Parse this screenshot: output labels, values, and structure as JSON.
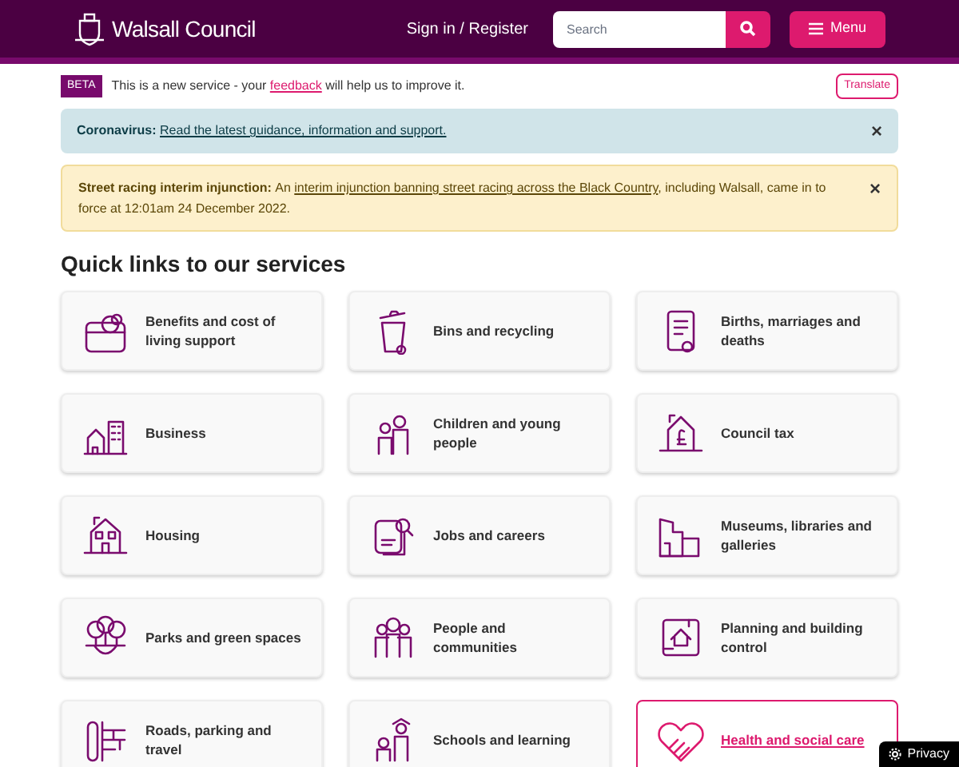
{
  "header": {
    "logo_text": "Walsall Council",
    "sign_in": "Sign in / Register",
    "search": {
      "placeholder": "Search"
    },
    "menu_button": "Menu"
  },
  "beta_banner": {
    "badge": "BETA",
    "text_before": "This is a new service - your ",
    "link": "feedback",
    "text_after": " will help us to improve it.",
    "translate_button": "Translate"
  },
  "alerts": [
    {
      "kind": "info",
      "lead": "Coronavirus:",
      "parts": [
        {
          "text": "Read the latest guidance, information and support.",
          "link": true
        }
      ],
      "close": "×"
    },
    {
      "kind": "warning",
      "lead": "Street racing interim injunction:",
      "parts": [
        {
          "text": "An ",
          "link": false
        },
        {
          "text": "interim injunction banning street racing across the Black Country",
          "link": true
        },
        {
          "text": ", including Walsall, came in to force at 12:01am 24 December 2022.",
          "link": false
        }
      ],
      "close": "×"
    }
  ],
  "quick_links": {
    "heading": "Quick links to our services",
    "items": [
      {
        "label": "Benefits and cost of living support",
        "highlighted": false
      },
      {
        "label": "Bins and recycling",
        "highlighted": false
      },
      {
        "label": "Births, marriages and deaths",
        "highlighted": false
      },
      {
        "label": "Business",
        "highlighted": false
      },
      {
        "label": "Children and young people",
        "highlighted": false
      },
      {
        "label": "Council tax",
        "highlighted": false
      },
      {
        "label": "Housing",
        "highlighted": false
      },
      {
        "label": "Jobs and careers",
        "highlighted": false
      },
      {
        "label": "Museums, libraries and galleries",
        "highlighted": false
      },
      {
        "label": "Parks and green spaces",
        "highlighted": false
      },
      {
        "label": "People and communities",
        "highlighted": false
      },
      {
        "label": "Planning and building control",
        "highlighted": false
      },
      {
        "label": "Roads, parking and travel",
        "highlighted": false
      },
      {
        "label": "Schools and learning",
        "highlighted": false
      },
      {
        "label": "Health and social care",
        "highlighted": true
      }
    ]
  },
  "privacy_button": "Privacy"
}
